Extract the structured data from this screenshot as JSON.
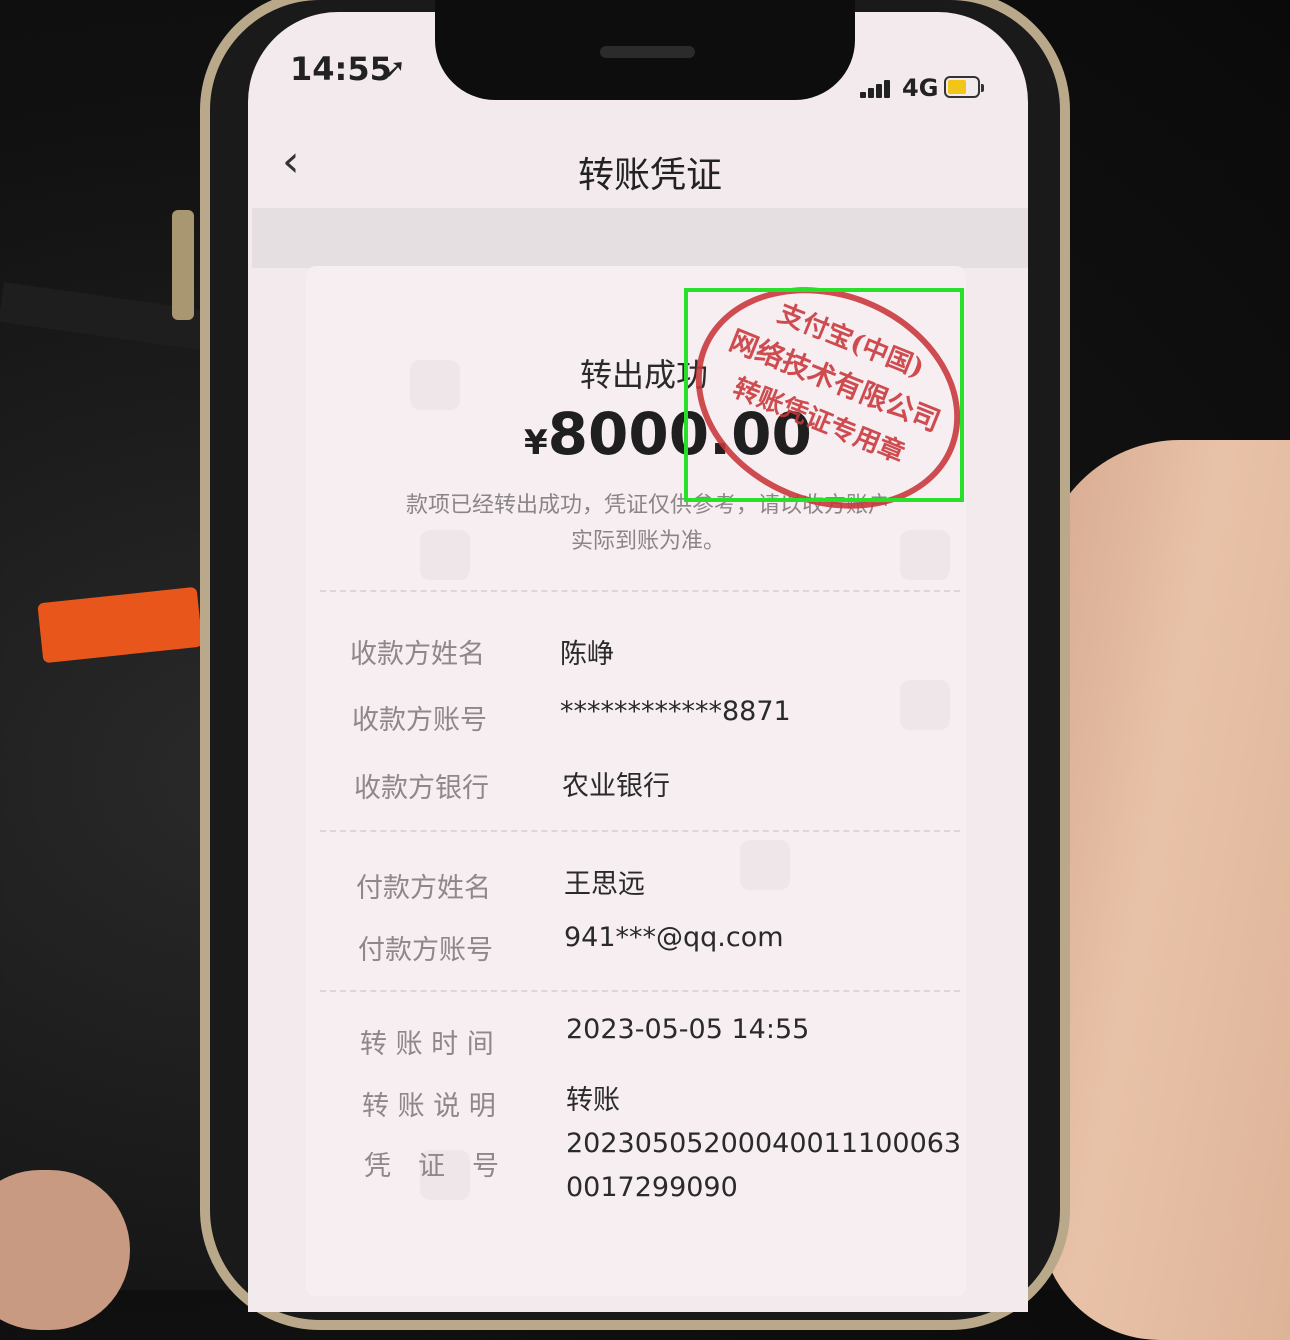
{
  "status_bar": {
    "time": "14:55",
    "network": "4G"
  },
  "nav": {
    "back_glyph": "‹",
    "title": "转账凭证"
  },
  "receipt": {
    "status": "转出成功",
    "currency": "¥",
    "amount": "8000.00",
    "note_line1": "款项已经转出成功，凭证仅供参考，请以收方账户",
    "note_line2": "实际到账为准。"
  },
  "payee": {
    "name_label": "收款方姓名",
    "name": "陈峥",
    "account_label": "收款方账号",
    "account": "************8871",
    "bank_label": "收款方银行",
    "bank": "农业银行"
  },
  "payer": {
    "name_label": "付款方姓名",
    "name": "王思远",
    "account_label": "付款方账号",
    "account": "941***@qq.com"
  },
  "transfer": {
    "time_label": "转 账 时 间",
    "time": "2023-05-05 14:55",
    "desc_label": "转 账 说 明",
    "desc": "转账",
    "voucher_label": "凭　证　号",
    "voucher_line1": "20230505200040011100063",
    "voucher_line2": "0017299090"
  },
  "seal": {
    "line1": "支付宝(中国)",
    "line2": "网络技术有限公司",
    "line3": "转账凭证专用章",
    "color": "#c9363a"
  },
  "highlight_color": "#28e02a"
}
